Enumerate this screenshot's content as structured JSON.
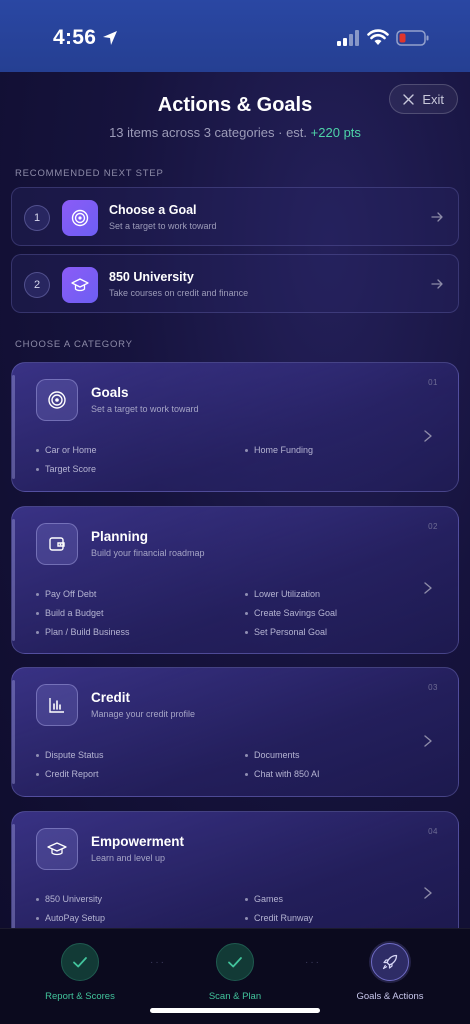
{
  "status_bar": {
    "time": "4:56",
    "icons": [
      "location-arrow-icon",
      "cellular-signal-icon",
      "wifi-icon",
      "battery-low-icon"
    ],
    "battery_color": "#e0352b"
  },
  "header": {
    "title": "Actions & Goals",
    "subtitle_prefix": "13 items across 3 categories · est.",
    "subtitle_points": "+220 pts",
    "exit_label": "Exit"
  },
  "recommended": {
    "label": "RECOMMENDED NEXT STEP",
    "steps": [
      {
        "number": "1",
        "title": "Choose a Goal",
        "desc": "Set a target to work toward",
        "icon": "target-icon"
      },
      {
        "number": "2",
        "title": "850 University",
        "desc": "Take courses on credit and finance",
        "icon": "graduation-cap-icon"
      }
    ]
  },
  "categories": {
    "label": "CHOOSE A CATEGORY",
    "items": [
      {
        "index": "01",
        "title": "Goals",
        "desc": "Set a target to work toward",
        "icon": "target-icon",
        "entries": [
          "Car or Home",
          "Home Funding",
          "Target Score"
        ]
      },
      {
        "index": "02",
        "title": "Planning",
        "desc": "Build your financial roadmap",
        "icon": "wallet-icon",
        "entries": [
          "Pay Off Debt",
          "Lower Utilization",
          "Build a Budget",
          "Create Savings Goal",
          "Plan / Build Business",
          "Set Personal Goal"
        ]
      },
      {
        "index": "03",
        "title": "Credit",
        "desc": "Manage your credit profile",
        "icon": "bar-chart-icon",
        "entries": [
          "Dispute Status",
          "Documents",
          "Credit Report",
          "Chat with 850 AI"
        ]
      },
      {
        "index": "04",
        "title": "Empowerment",
        "desc": "Learn and level up",
        "icon": "graduation-cap-icon",
        "entries": [
          "850 University",
          "Games",
          "AutoPay Setup",
          "Credit Runway"
        ]
      }
    ]
  },
  "tab_bar": {
    "tabs": [
      {
        "label": "Report & Scores",
        "state": "done",
        "icon": "check-icon"
      },
      {
        "label": "Scan & Plan",
        "state": "done",
        "icon": "check-icon"
      },
      {
        "label": "Goals & Actions",
        "state": "active",
        "icon": "rocket-icon"
      }
    ],
    "separator": "···"
  }
}
